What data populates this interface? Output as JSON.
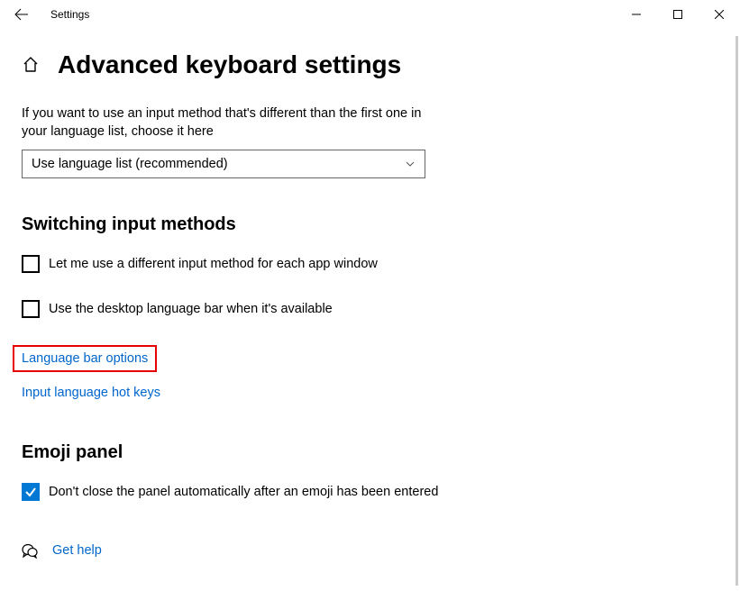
{
  "window": {
    "app_title": "Settings"
  },
  "page": {
    "title": "Advanced keyboard settings",
    "description": "If you want to use an input method that's different than the first one in your language list, choose it here",
    "dropdown_value": "Use language list (recommended)"
  },
  "section_switching": {
    "title": "Switching input methods",
    "cb1_label": "Let me use a different input method for each app window",
    "cb1_checked": false,
    "cb2_label": "Use the desktop language bar when it's available",
    "cb2_checked": false,
    "link_language_bar": "Language bar options",
    "link_hotkeys": "Input language hot keys"
  },
  "section_emoji": {
    "title": "Emoji panel",
    "cb_label": "Don't close the panel automatically after an emoji has been entered",
    "cb_checked": true
  },
  "help": {
    "label": "Get help"
  }
}
